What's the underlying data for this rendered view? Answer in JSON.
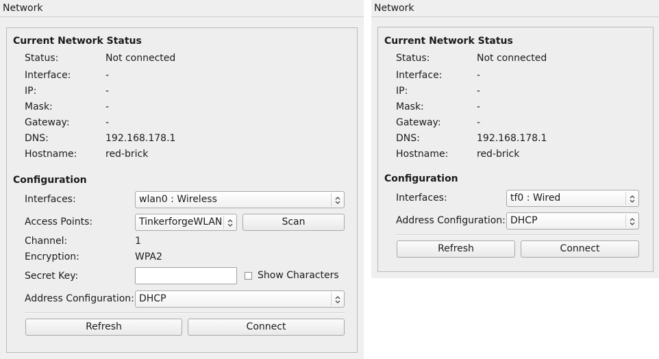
{
  "left": {
    "title": "Network",
    "status_heading": "Current Network Status",
    "status": [
      {
        "label": "Status:",
        "value": "Not connected"
      },
      {
        "label": "Interface:",
        "value": "-"
      },
      {
        "label": "IP:",
        "value": "-"
      },
      {
        "label": "Mask:",
        "value": "-"
      },
      {
        "label": "Gateway:",
        "value": "-"
      },
      {
        "label": "DNS:",
        "value": "192.168.178.1"
      },
      {
        "label": "Hostname:",
        "value": "red-brick"
      }
    ],
    "config_heading": "Configuration",
    "interfaces_label": "Interfaces:",
    "interfaces_value": "wlan0 : Wireless",
    "access_points_label": "Access Points:",
    "access_points_value": "TinkerforgeWLAN",
    "scan_label": "Scan",
    "channel_label": "Channel:",
    "channel_value": "1",
    "encryption_label": "Encryption:",
    "encryption_value": "WPA2",
    "secret_key_label": "Secret Key:",
    "secret_key_value": "",
    "show_characters_label": "Show Characters",
    "address_config_label": "Address Configuration:",
    "address_config_value": "DHCP",
    "refresh_label": "Refresh",
    "connect_label": "Connect"
  },
  "right": {
    "title": "Network",
    "status_heading": "Current Network Status",
    "status": [
      {
        "label": "Status:",
        "value": "Not connected"
      },
      {
        "label": "Interface:",
        "value": "-"
      },
      {
        "label": "IP:",
        "value": "-"
      },
      {
        "label": "Mask:",
        "value": "-"
      },
      {
        "label": "Gateway:",
        "value": "-"
      },
      {
        "label": "DNS:",
        "value": "192.168.178.1"
      },
      {
        "label": "Hostname:",
        "value": "red-brick"
      }
    ],
    "config_heading": "Configuration",
    "interfaces_label": "Interfaces:",
    "interfaces_value": "tf0 : Wired",
    "address_config_label": "Address Configuration:",
    "address_config_value": "DHCP",
    "refresh_label": "Refresh",
    "connect_label": "Connect"
  }
}
